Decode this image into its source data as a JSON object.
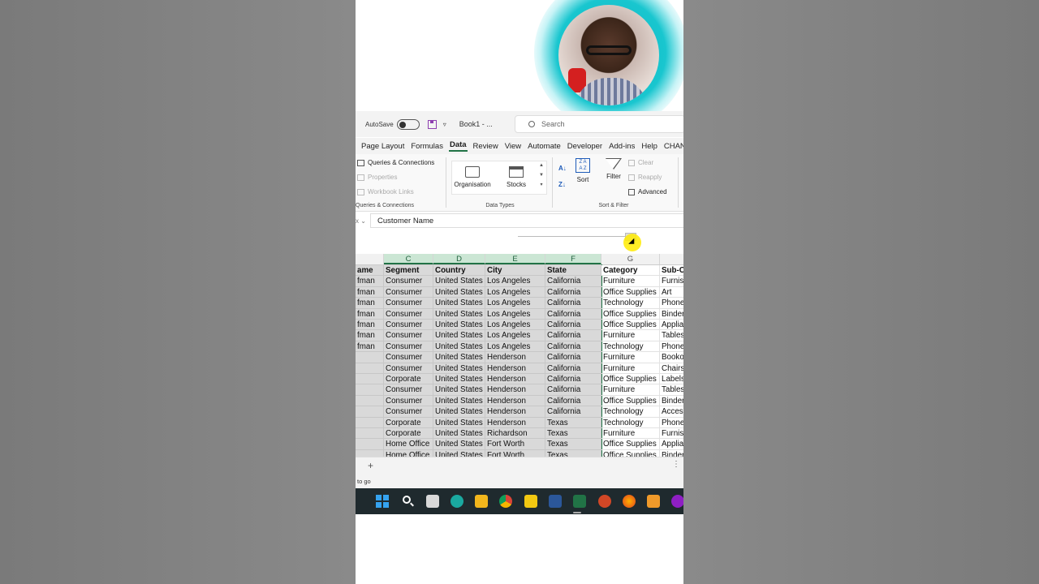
{
  "titlebar": {
    "autosave_label": "AutoSave",
    "book_name": "Book1 - ...",
    "search_placeholder": "Search"
  },
  "tabs": [
    "Page Layout",
    "Formulas",
    "Data",
    "Review",
    "View",
    "Automate",
    "Developer",
    "Add-ins",
    "Help",
    "CHANGE"
  ],
  "active_tab": "Data",
  "ribbon": {
    "queries": {
      "items": [
        "Queries & Connections",
        "Properties",
        "Workbook Links"
      ],
      "label": "Queries & Connections"
    },
    "data_types": {
      "buttons": [
        "Organisation",
        "Stocks"
      ],
      "label": "Data Types"
    },
    "sort_filter": {
      "sort": "Sort",
      "filter": "Filter",
      "clear": "Clear",
      "reapply": "Reapply",
      "advanced": "Advanced",
      "label": "Sort & Filter"
    }
  },
  "formula_bar": {
    "indicator": "x",
    "content": "Customer Name"
  },
  "columns": [
    "",
    "C",
    "D",
    "E",
    "F",
    "G",
    ""
  ],
  "headers": [
    "ame",
    "Segment",
    "Country",
    "City",
    "State",
    "Category",
    "Sub-C"
  ],
  "rows": [
    [
      "fman",
      "Consumer",
      "United States",
      "Los Angeles",
      "California",
      "Furniture",
      "Furnis"
    ],
    [
      "fman",
      "Consumer",
      "United States",
      "Los Angeles",
      "California",
      "Office Supplies",
      "Art"
    ],
    [
      "fman",
      "Consumer",
      "United States",
      "Los Angeles",
      "California",
      "Technology",
      "Phone"
    ],
    [
      "fman",
      "Consumer",
      "United States",
      "Los Angeles",
      "California",
      "Office Supplies",
      "Binder"
    ],
    [
      "fman",
      "Consumer",
      "United States",
      "Los Angeles",
      "California",
      "Office Supplies",
      "Applia"
    ],
    [
      "fman",
      "Consumer",
      "United States",
      "Los Angeles",
      "California",
      "Furniture",
      "Tables"
    ],
    [
      "fman",
      "Consumer",
      "United States",
      "Los Angeles",
      "California",
      "Technology",
      "Phone"
    ],
    [
      "",
      "Consumer",
      "United States",
      "Henderson",
      "California",
      "Furniture",
      "Booko"
    ],
    [
      "",
      "Consumer",
      "United States",
      "Henderson",
      "California",
      "Furniture",
      "Chairs"
    ],
    [
      "",
      "Corporate",
      "United States",
      "Henderson",
      "California",
      "Office Supplies",
      "Labels"
    ],
    [
      "",
      "Consumer",
      "United States",
      "Henderson",
      "California",
      "Furniture",
      "Tables"
    ],
    [
      "",
      "Consumer",
      "United States",
      "Henderson",
      "California",
      "Office Supplies",
      "Binder"
    ],
    [
      "",
      "Consumer",
      "United States",
      "Henderson",
      "California",
      "Technology",
      "Acces"
    ],
    [
      "",
      "Corporate",
      "United States",
      "Henderson",
      "Texas",
      "Technology",
      "Phone"
    ],
    [
      "",
      "Corporate",
      "United States",
      "Richardson",
      "Texas",
      "Furniture",
      "Furnis"
    ],
    [
      "",
      "Home Office",
      "United States",
      "Fort Worth",
      "Texas",
      "Office Supplies",
      "Applia"
    ],
    [
      "",
      "Home Office",
      "United States",
      "Fort Worth",
      "Texas",
      "Office Supplies",
      "Binder"
    ]
  ],
  "sheetbar": {
    "add": "+",
    "more": "⋮"
  },
  "status_text": "to go",
  "taskbar_apps": [
    "windows-start",
    "search",
    "task-view",
    "edge",
    "file-explorer",
    "chrome",
    "power-bi",
    "word",
    "excel",
    "powerpoint",
    "firefox",
    "app-orange",
    "app-purple"
  ],
  "colors": {
    "excel_green": "#217346",
    "selection_gray": "#d9d9d9",
    "webcam_glow": "#19c6cf"
  }
}
